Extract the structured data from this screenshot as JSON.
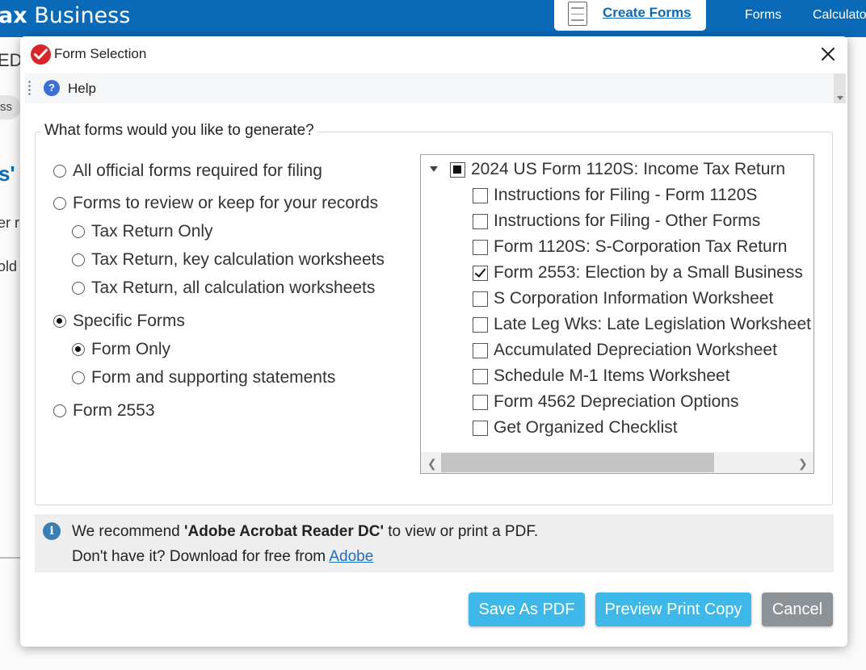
{
  "background": {
    "brand": {
      "prefix": "ax",
      "suffix": "Business"
    },
    "create_forms_label": "Create Forms",
    "nav": {
      "forms": "Forms",
      "calculator": "Calculato"
    },
    "fragments": {
      "ed": "ED",
      "pill": "ss",
      "s_quote": "s'",
      "er": "er r",
      "old": "old"
    }
  },
  "dialog": {
    "title": "Form Selection",
    "help_label": "Help",
    "question": "What forms would you like to generate?",
    "options": {
      "all_official": "All official forms required for filing",
      "review_keep": "Forms to review or keep for your records",
      "tax_return_only": "Tax Return Only",
      "tax_return_key": "Tax Return, key calculation worksheets",
      "tax_return_all": "Tax Return, all calculation worksheets",
      "specific_forms": "Specific Forms",
      "form_only": "Form Only",
      "form_supporting": "Form and supporting statements",
      "form_2553": "Form 2553"
    },
    "selected_options": [
      "specific_forms",
      "form_only"
    ],
    "tree": {
      "root_label": "2024 US Form 1120S: Income Tax Return",
      "root_state": "partial",
      "items": [
        {
          "label": "Instructions for Filing - Form 1120S",
          "checked": false
        },
        {
          "label": "Instructions for Filing - Other Forms",
          "checked": false
        },
        {
          "label": "Form 1120S: S-Corporation Tax Return",
          "checked": false
        },
        {
          "label": "Form 2553: Election by a Small Business",
          "checked": true
        },
        {
          "label": "S Corporation Information Worksheet",
          "checked": false
        },
        {
          "label": "Late Leg Wks: Late Legislation Worksheet",
          "checked": false
        },
        {
          "label": "Accumulated Depreciation Worksheet",
          "checked": false
        },
        {
          "label": "Schedule M-1 Items Worksheet",
          "checked": false
        },
        {
          "label": "Form 4562 Depreciation Options",
          "checked": false
        },
        {
          "label": "Get Organized Checklist",
          "checked": false
        }
      ]
    },
    "info": {
      "line1_prefix": "We recommend ",
      "line1_bold": "'Adobe Acrobat Reader DC'",
      "line1_suffix": " to view or print a PDF.",
      "line2_prefix": "Don't have it? Download for free from ",
      "line2_link": "Adobe"
    },
    "buttons": {
      "save_pdf": "Save As PDF",
      "preview": "Preview Print Copy",
      "cancel": "Cancel"
    }
  },
  "colors": {
    "header_blue": "#0a6ab8",
    "button_blue": "#3db8e8",
    "cancel_gray": "#8d9297",
    "title_check_red": "#d9262b"
  }
}
